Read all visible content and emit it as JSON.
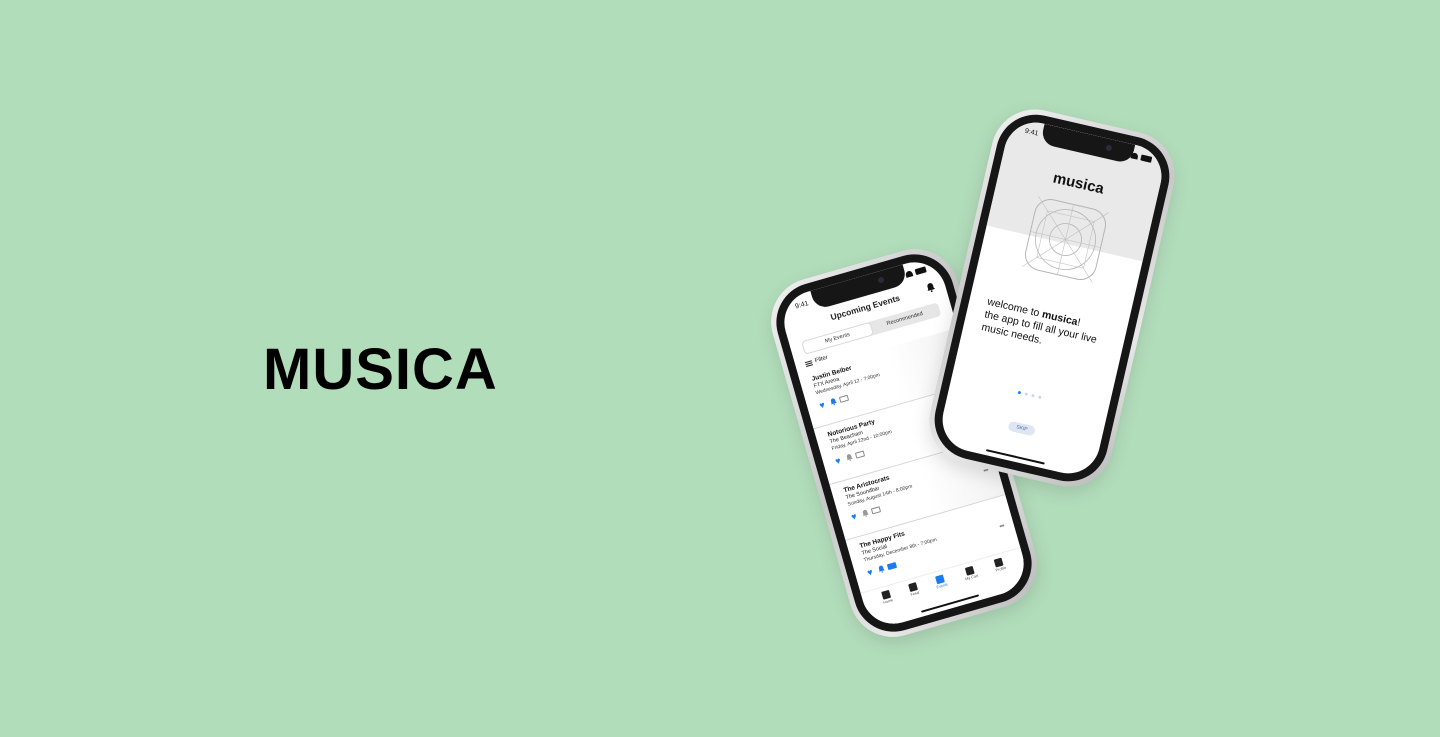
{
  "brand_title": "MUSICA",
  "colors": {
    "background": "#b2ddbb",
    "accent": "#1a7cf0"
  },
  "events_screen": {
    "status_time": "9:41",
    "header": "Upcoming Events",
    "segments": [
      "My Events",
      "Recommended"
    ],
    "active_segment": "My Events",
    "filter_label": "Filter",
    "events": [
      {
        "name": "Justin Beiber",
        "venue": "FTX Arena",
        "date": "Wednesday, April 12 - 7:00pm"
      },
      {
        "name": "Notorious Party",
        "venue": "The Beacham",
        "date": "Friday, April 22nd - 10:00pm"
      },
      {
        "name": "The Aristocrats",
        "venue": "The Soundbar",
        "date": "Sunday, August 14th - 8:00pm"
      },
      {
        "name": "The Happy Fits",
        "venue": "The Social",
        "date": "Thursday, December 8th - 7:00pm"
      }
    ],
    "tabs": [
      "Home",
      "Feed",
      "Events",
      "My Cart",
      "Profile"
    ],
    "active_tab": "Events"
  },
  "welcome_screen": {
    "status_time": "9:41",
    "brand": "musica",
    "text_prefix": "welcome to ",
    "text_brand": "musica",
    "text_suffix": "!",
    "text_line2": "the app to fill all your live music needs.",
    "skip_label": "SKIP"
  }
}
